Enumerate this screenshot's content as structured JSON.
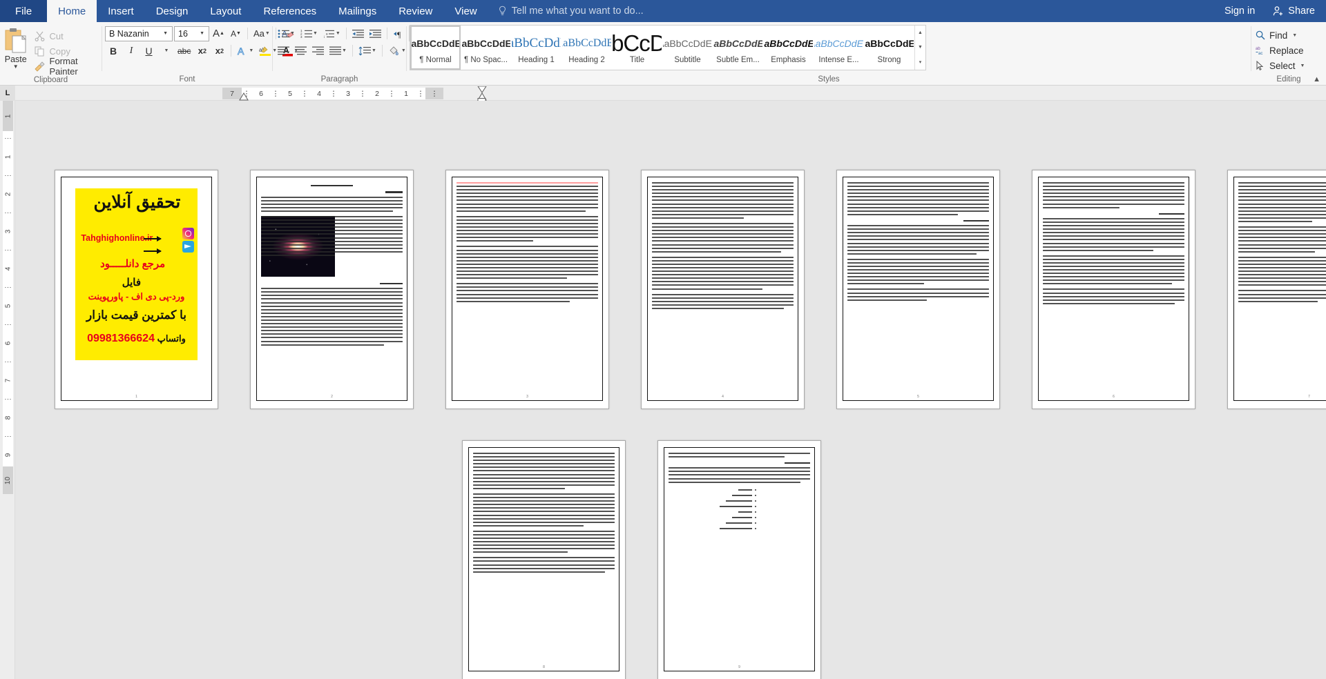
{
  "app": {
    "tabs": [
      {
        "id": "file",
        "label": "File"
      },
      {
        "id": "home",
        "label": "Home"
      },
      {
        "id": "insert",
        "label": "Insert"
      },
      {
        "id": "design",
        "label": "Design"
      },
      {
        "id": "layout",
        "label": "Layout"
      },
      {
        "id": "references",
        "label": "References"
      },
      {
        "id": "mailings",
        "label": "Mailings"
      },
      {
        "id": "review",
        "label": "Review"
      },
      {
        "id": "view",
        "label": "View"
      }
    ],
    "tell_me": "Tell me what you want to do...",
    "sign_in": "Sign in",
    "share": "Share",
    "accent_color": "#2b579a",
    "file_tab_color": "#204785"
  },
  "ribbon": {
    "clipboard": {
      "label": "Clipboard",
      "paste": "Paste",
      "cut": "Cut",
      "copy": "Copy",
      "format_painter": "Format Painter"
    },
    "font": {
      "label": "Font",
      "font_name": "B Nazanin",
      "font_size": "16",
      "grow_font": "A",
      "shrink_font": "A",
      "change_case": "Aa",
      "clear_formatting": "A",
      "bold": "B",
      "italic": "I",
      "underline": "U",
      "strikethrough": "abc",
      "subscript": "x",
      "superscript": "x",
      "text_effects": "A",
      "highlight": "ab",
      "font_color": "A",
      "highlight_color": "#ffe400",
      "font_color_swatch": "#e00000"
    },
    "paragraph": {
      "label": "Paragraph",
      "ltr_active": false,
      "rtl_active": true
    },
    "styles": {
      "label": "Styles",
      "items": [
        {
          "name": "Normal",
          "preview": "AaBbCcDdEe",
          "selected": true
        },
        {
          "name": "No Spac...",
          "preview": "AaBbCcDdEe",
          "selected": false
        },
        {
          "name": "Heading 1",
          "preview": "AaBbCcDdEe",
          "selected": false
        },
        {
          "name": "Heading 2",
          "preview": "AaBbCcDdEe",
          "selected": false
        },
        {
          "name": "Title",
          "preview": "AaBbCcDdEe",
          "selected": false
        },
        {
          "name": "Subtitle",
          "preview": "AaBbCcDdEe",
          "selected": false
        },
        {
          "name": "Subtle Em...",
          "preview": "AaBbCcDdEe",
          "selected": false
        },
        {
          "name": "Emphasis",
          "preview": "AaBbCcDdEe",
          "selected": false
        },
        {
          "name": "Intense E...",
          "preview": "AaBbCcDdEe",
          "selected": false
        },
        {
          "name": "Strong",
          "preview": "AaBbCcDdEe",
          "selected": false
        }
      ]
    },
    "editing": {
      "label": "Editing",
      "find": "Find",
      "replace": "Replace",
      "select": "Select"
    }
  },
  "ruler": {
    "tab_stop_marker": "L",
    "horizontal_rtl": true,
    "horizontal_ticks": [
      "7",
      "6",
      "5",
      "4",
      "3",
      "2",
      "1"
    ],
    "vertical_ticks": [
      "1",
      "1",
      "2",
      "3",
      "4",
      "5",
      "6",
      "7",
      "8",
      "9",
      "10"
    ]
  },
  "document": {
    "page_count": 9,
    "pages": [
      {
        "number": "1",
        "type": "poster"
      },
      {
        "number": "2",
        "type": "text-image"
      },
      {
        "number": "3",
        "type": "text"
      },
      {
        "number": "4",
        "type": "text"
      },
      {
        "number": "5",
        "type": "text"
      },
      {
        "number": "6",
        "type": "text"
      },
      {
        "number": "7",
        "type": "text"
      },
      {
        "number": "8",
        "type": "text"
      },
      {
        "number": "9",
        "type": "list"
      }
    ],
    "title_heading": "کهکشان و سیاره",
    "section_headings": [
      "مقدمه",
      "واژه شناسی",
      "میدان",
      "منظومه شمسی"
    ],
    "poster": {
      "brand_title": "تحقیق آنلاین",
      "url": "Tahghighonline.ir",
      "line1": "مرجع دانلـــــود",
      "line2": "فایل",
      "line3": "ورد-پی دی اف - پاورپوینت",
      "line4": "با کمترین قیمت بازار",
      "phone": "09981366624",
      "whatsapp": "واتساپ",
      "bg_color": "#ffec00",
      "red_color": "#e8001c",
      "icons": [
        "instagram-icon",
        "telegram-icon"
      ]
    },
    "planet_list": [
      "تیر",
      "ناهید",
      "زمین",
      "بهرام",
      "مشتری",
      "کیوان",
      "اورانوس",
      "نپتون"
    ]
  }
}
